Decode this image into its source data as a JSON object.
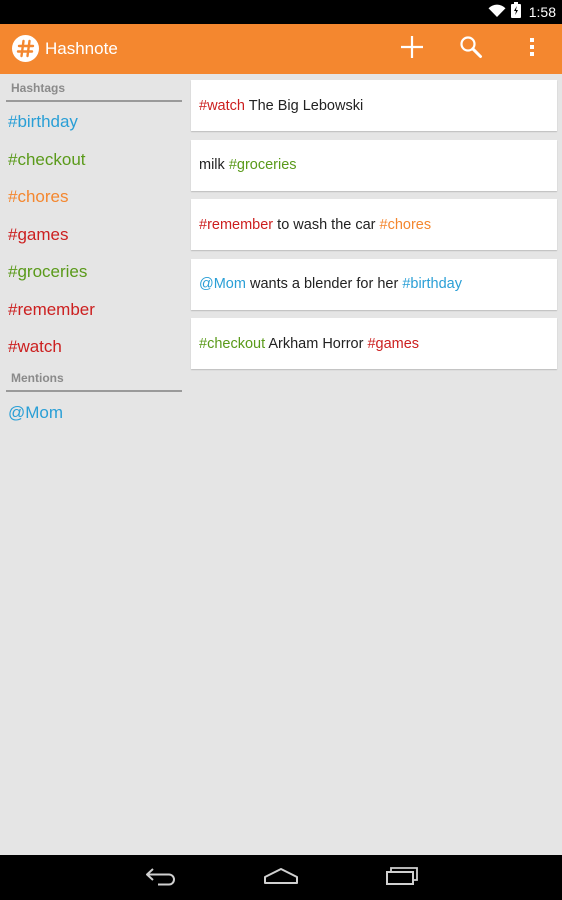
{
  "status_bar": {
    "time": "1:58",
    "icons": [
      "wifi-icon",
      "battery-icon"
    ]
  },
  "action_bar": {
    "title": "Hashnote",
    "actions": [
      {
        "name": "add-icon"
      },
      {
        "name": "search-icon"
      },
      {
        "name": "overflow-menu-icon"
      }
    ]
  },
  "sidebar": {
    "hashtags_header": "Hashtags",
    "hashtags": [
      {
        "label": "#birthday",
        "color": "#2a9fd6"
      },
      {
        "label": "#checkout",
        "color": "#5a9a1a"
      },
      {
        "label": "#chores",
        "color": "#f4872f"
      },
      {
        "label": "#games",
        "color": "#cc1f1f"
      },
      {
        "label": "#groceries",
        "color": "#5a9a1a"
      },
      {
        "label": "#remember",
        "color": "#cc1f1f"
      },
      {
        "label": "#watch",
        "color": "#cc1f1f"
      }
    ],
    "mentions_header": "Mentions",
    "mentions": [
      {
        "label": "@Mom",
        "color": "#2a9fd6"
      }
    ]
  },
  "notes": [
    {
      "segments": [
        {
          "text": "#watch",
          "color": "#cc1f1f"
        },
        {
          "text": " The Big Lebowski",
          "color": "#222222"
        }
      ]
    },
    {
      "segments": [
        {
          "text": "milk ",
          "color": "#222222"
        },
        {
          "text": "#groceries",
          "color": "#5a9a1a"
        }
      ]
    },
    {
      "segments": [
        {
          "text": "#remember",
          "color": "#cc1f1f"
        },
        {
          "text": " to wash the car ",
          "color": "#222222"
        },
        {
          "text": "#chores",
          "color": "#f4872f"
        }
      ]
    },
    {
      "segments": [
        {
          "text": "@Mom",
          "color": "#2a9fd6"
        },
        {
          "text": " wants a blender for her ",
          "color": "#222222"
        },
        {
          "text": "#birthday",
          "color": "#2a9fd6"
        }
      ]
    },
    {
      "segments": [
        {
          "text": "#checkout",
          "color": "#5a9a1a"
        },
        {
          "text": " Arkham Horror ",
          "color": "#222222"
        },
        {
          "text": "#games",
          "color": "#cc1f1f"
        }
      ]
    }
  ],
  "nav_bar": {
    "buttons": [
      {
        "name": "back-icon"
      },
      {
        "name": "home-icon"
      },
      {
        "name": "recent-apps-icon"
      }
    ]
  },
  "colors": {
    "accent": "#f4872f",
    "background": "#e5e5e5"
  }
}
